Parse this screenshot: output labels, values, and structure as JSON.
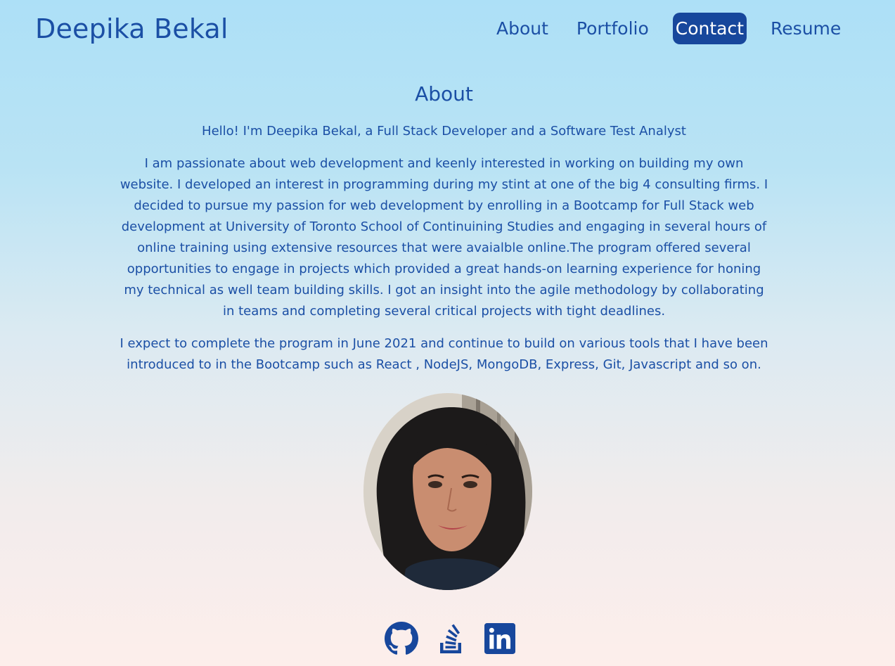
{
  "header": {
    "brand": "Deepika Bekal",
    "nav": [
      {
        "label": "About",
        "active": false
      },
      {
        "label": "Portfolio",
        "active": false
      },
      {
        "label": "Contact",
        "active": true
      },
      {
        "label": "Resume",
        "active": false
      }
    ]
  },
  "about": {
    "title": "About",
    "intro": "Hello! I'm Deepika Bekal, a Full Stack Developer and a Software Test Analyst",
    "paragraph1": "I am passionate about web development and keenly interested in working on building my own website. I developed an interest in programming during my stint at one of the big 4 consulting firms. I decided to pursue my passion for web development by enrolling in a Bootcamp for Full Stack web development at University of Toronto School of Continuining Studies and engaging in several hours of online training using extensive resources that were avaialble online.The program offered several opportunities to engage in projects which provided a great hands-on learning experience for honing my technical as well team building skills. I got an insight into the agile methodology by collaborating in teams and completing several critical projects with tight deadlines.",
    "paragraph2": "I expect to complete the program in June 2021 and continue to build on various tools that I have been introduced to in the Bootcamp such as React , NodeJS, MongoDB, Express, Git, Javascript and so on."
  },
  "socials": [
    {
      "icon": "github-icon"
    },
    {
      "icon": "stackoverflow-icon"
    },
    {
      "icon": "linkedin-icon"
    }
  ],
  "colors": {
    "primary": "#1b4fa5",
    "active_bg": "#17479c",
    "bg_top": "#ade0f7",
    "bg_bottom": "#fdeeeb"
  }
}
